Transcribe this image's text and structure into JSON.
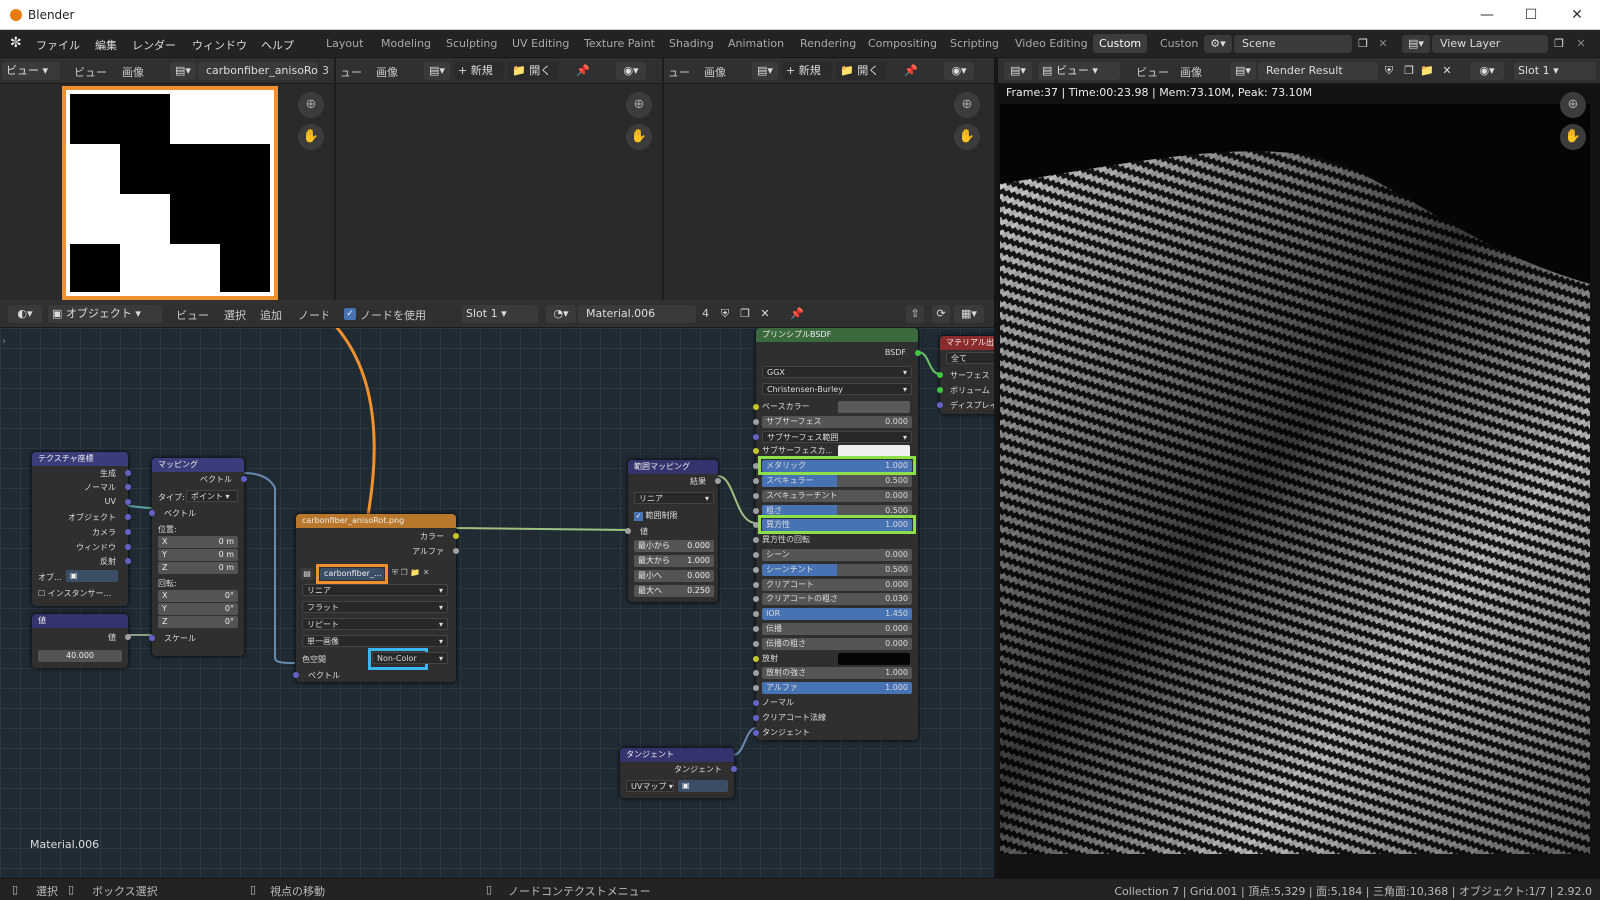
{
  "window": {
    "title": "Blender"
  },
  "menu": {
    "items": [
      "ファイル",
      "編集",
      "レンダー",
      "ウィンドウ",
      "ヘルプ"
    ]
  },
  "workspaces": [
    "Layout",
    "Modeling",
    "Sculpting",
    "UV Editing",
    "Texture Paint",
    "Shading",
    "Animation",
    "Rendering",
    "Compositing",
    "Scripting",
    "Video Editing",
    "Custom",
    "Custon"
  ],
  "active_workspace": "Custom",
  "scene": {
    "name": "Scene",
    "view_layer": "View Layer"
  },
  "image_editor1": {
    "view_menu": "ビュー",
    "menus": [
      "ビュー",
      "画像"
    ],
    "image_name": "carbonfiber_anisoRo...",
    "users": "3"
  },
  "image_editor2": {
    "view_menu": "ビュー",
    "menus": [
      "ュー",
      "画像"
    ],
    "new_label": "新規",
    "open_label": "開く"
  },
  "image_editor3": {
    "menus": [
      "ュー",
      "画像"
    ],
    "new_label": "新規",
    "open_label": "開く"
  },
  "render_view": {
    "menus": [
      "ビュー",
      "ビュー",
      "画像"
    ],
    "image_name": "Render Result",
    "slot": "Slot 1",
    "info": "Frame:37 | Time:00:23.98 | Mem:73.10M, Peak: 73.10M"
  },
  "node_header": {
    "mode": "オブジェクト",
    "menus": [
      "ビュー",
      "選択",
      "追加",
      "ノード"
    ],
    "use_nodes": "ノードを使用",
    "slot": "Slot 1",
    "material": "Material.006",
    "users": "4"
  },
  "material_label": "Material.006",
  "nodes": {
    "texcoord": {
      "title": "テクスチャ座標",
      "outputs": [
        "生成",
        "ノーマル",
        "UV",
        "オブジェクト",
        "カメラ",
        "ウィンドウ",
        "反射"
      ],
      "object_label": "オブ...",
      "instancer": "インスタンサー..."
    },
    "value": {
      "title": "値",
      "output": "値",
      "value": "40.000"
    },
    "mapping": {
      "title": "マッピング",
      "output": "ベクトル",
      "type_label": "タイプ:",
      "type_value": "ポイント",
      "vector": "ベクトル",
      "location_label": "位置:",
      "loc": [
        [
          "X",
          "0 m"
        ],
        [
          "Y",
          "0 m"
        ],
        [
          "Z",
          "0 m"
        ]
      ],
      "rotation_label": "回転:",
      "rot": [
        [
          "X",
          "0°"
        ],
        [
          "Y",
          "0°"
        ],
        [
          "Z",
          "0°"
        ]
      ],
      "scale": "スケール"
    },
    "image_texture": {
      "title": "carbonfiber_anisoRot.png",
      "outputs": [
        "カラー",
        "アルファ"
      ],
      "image_name": "carbonfiber_...",
      "interpolation": "リニア",
      "projection": "フラット",
      "extension": "リピート",
      "source": "単一画像",
      "colorspace_label": "色空間",
      "colorspace": "Non-Color",
      "vector": "ベクトル"
    },
    "map_range": {
      "title": "範囲マッピング",
      "output": "結果",
      "type": "リニア",
      "clamp": "範囲制限",
      "value_label": "値",
      "fields": [
        [
          "最小から",
          "0.000"
        ],
        [
          "最大から",
          "1.000"
        ],
        [
          "最小へ",
          "0.000"
        ],
        [
          "最大へ",
          "0.250"
        ]
      ]
    },
    "tangent": {
      "title": "タンジェント",
      "output": "タンジェント",
      "mode": "UVマップ"
    },
    "bsdf": {
      "title": "プリンシプルBSDF",
      "output": "BSDF",
      "distribution": "GGX",
      "subsurface_method": "Christensen-Burley",
      "rows": [
        [
          "ベースカラー",
          "",
          "color"
        ],
        [
          "サブサーフェス",
          "0.000",
          "val"
        ],
        [
          "サブサーフェス範囲",
          "",
          "select"
        ],
        [
          "サブサーフェスカ...",
          "",
          "white"
        ],
        [
          "メタリック",
          "1.000",
          "blue"
        ],
        [
          "スペキュラー",
          "0.500",
          "half"
        ],
        [
          "スペキュラーチント",
          "0.000",
          "val"
        ],
        [
          "粗さ",
          "0.500",
          "half"
        ],
        [
          "異方性",
          "1.000",
          "blue"
        ],
        [
          "異方性の回転",
          "",
          "label"
        ],
        [
          "シーン",
          "0.000",
          "val"
        ],
        [
          "シーンチント",
          "0.500",
          "half"
        ],
        [
          "クリアコート",
          "0.000",
          "val"
        ],
        [
          "クリアコートの粗さ",
          "0.030",
          "val"
        ],
        [
          "IOR",
          "1.450",
          "blue"
        ],
        [
          "伝播",
          "0.000",
          "val"
        ],
        [
          "伝播の粗さ",
          "0.000",
          "val"
        ],
        [
          "放射",
          "",
          "black"
        ],
        [
          "放射の強さ",
          "1.000",
          "val"
        ],
        [
          "アルファ",
          "1.000",
          "blue"
        ],
        [
          "ノーマル",
          "",
          "label"
        ],
        [
          "クリアコート法線",
          "",
          "label"
        ],
        [
          "タンジェント",
          "",
          "label"
        ]
      ]
    },
    "output": {
      "title": "マテリアル出力",
      "target": "全て",
      "inputs": [
        "サーフェス",
        "ボリューム",
        "ディスプレイ..."
      ]
    }
  },
  "statusbar": {
    "select": "選択",
    "box_select": "ボックス選択",
    "move_view": "視点の移動",
    "context_menu": "ノードコンテクストメニュー",
    "stats": "Collection 7 | Grid.001 | 頂点:5,329 | 面:5,184 | 三角面:10,368 | オブジェクト:1/7 | 2.92.0"
  },
  "colors": {
    "highlight_orange": "#f0902e",
    "highlight_green": "#8ee04a",
    "highlight_blue": "#3ab7f0",
    "node_shader": "#3c6a3f",
    "node_texture": "#b8772a",
    "node_vector": "#3a3d7a",
    "node_converter": "#35336e"
  }
}
